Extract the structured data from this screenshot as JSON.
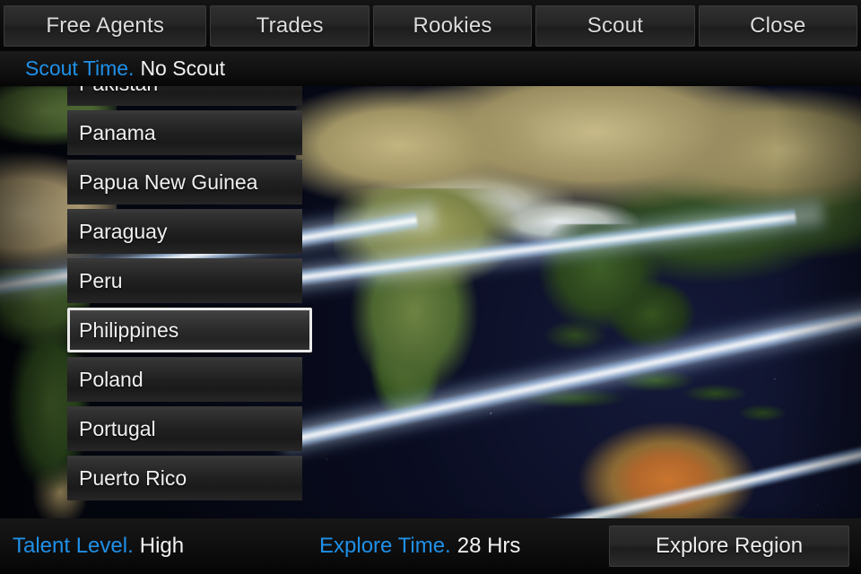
{
  "topbar": {
    "tabs": [
      {
        "label": "Free Agents",
        "name": "tab-free-agents"
      },
      {
        "label": "Trades",
        "name": "tab-trades"
      },
      {
        "label": "Rookies",
        "name": "tab-rookies"
      },
      {
        "label": "Scout",
        "name": "tab-scout"
      },
      {
        "label": "Close",
        "name": "tab-close"
      }
    ]
  },
  "infostrip": {
    "scout_time_label": "Scout Time.",
    "scout_time_value": "No Scout"
  },
  "country_list": {
    "items": [
      {
        "label": "Pakistan",
        "selected": false
      },
      {
        "label": "Panama",
        "selected": false
      },
      {
        "label": "Papua New Guinea",
        "selected": false
      },
      {
        "label": "Paraguay",
        "selected": false
      },
      {
        "label": "Peru",
        "selected": false
      },
      {
        "label": "Philippines",
        "selected": true
      },
      {
        "label": "Poland",
        "selected": false
      },
      {
        "label": "Portugal",
        "selected": false
      },
      {
        "label": "Puerto Rico",
        "selected": false
      }
    ],
    "selected_item": "Philippines"
  },
  "bottombar": {
    "talent_label": "Talent Level.",
    "talent_value": "High",
    "explore_label": "Explore Time.",
    "explore_value": "28 Hrs",
    "action_label": "Explore Region"
  },
  "map": {
    "name": "satellite-world-map",
    "description": "Satellite view of Asia, Southeast Asia and Australia over starfield"
  },
  "colors": {
    "accent_blue": "#1f90e8",
    "text_white": "#f2f2f2",
    "panel_dark": "#1d1d1d",
    "selected_border": "#e9e9e9"
  }
}
